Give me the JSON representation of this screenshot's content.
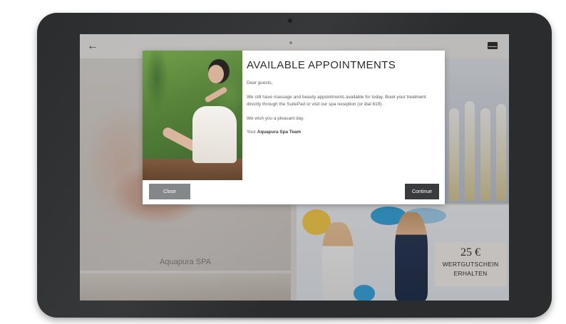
{
  "header": {
    "back_icon": "arrow-left-icon",
    "mail_icon": "envelope-icon"
  },
  "tiles": {
    "massage_caption": "Aquapura SPA",
    "voucher": {
      "amount": "25 €",
      "line1": "WERTGUTSCHEIN",
      "line2": "ERHALTEN"
    }
  },
  "modal": {
    "title": "AVAILABLE APPOINTMENTS",
    "greeting": "Dear guests,",
    "message": "We still have massage and beauty appointments available for today. Book your treatment directly through the SuitePad or visit our spa reception (or dial 819).",
    "wish": "We wish you a pleasant day.",
    "signoff_prefix": "Your",
    "signoff_brand": "Aquapura Spa Team",
    "close_label": "Close",
    "continue_label": "Continue"
  },
  "colors": {
    "device": "#2b2c2e",
    "button_close": "#7e8184",
    "button_continue": "#3a3b3d"
  }
}
